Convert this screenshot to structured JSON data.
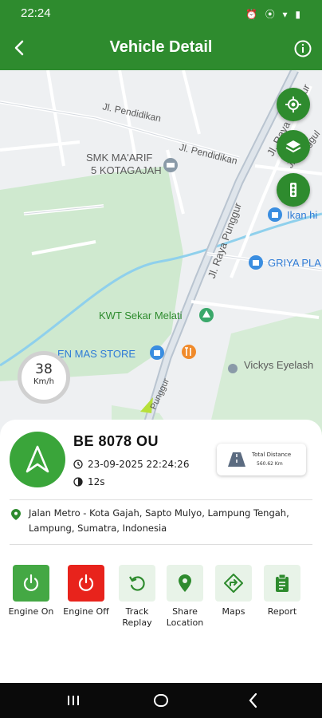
{
  "status": {
    "time": "22:24"
  },
  "header": {
    "title": "Vehicle Detail"
  },
  "map": {
    "labels": {
      "pendidikan1": "Jl. Pendidikan",
      "pendidikan2": "Jl. Pendidikan",
      "smk1": "SMK MA'ARIF",
      "smk2": "5 KOTAGAJAH",
      "raya_punggur_top": "Jl. Raya Punggur",
      "tanggul": "Jl. Tanggul",
      "ikan": "Ikan hi",
      "griya": "GRIYA PLA",
      "raya_punggur_mid": "Jl. Raya Punggur",
      "kwt": "KWT Sekar Melati",
      "store": "EN MAS STORE",
      "vickys": "Vickys Eyelash",
      "punggur_bottom": "Punggur"
    }
  },
  "speed": {
    "value": "38",
    "unit": "Km/h"
  },
  "vehicle": {
    "plate": "BE 8078 OU",
    "datetime": "23-09-2025 22:24:26",
    "duration": "12s",
    "distance_label": "Total Distance",
    "distance_value": "560.62 Km",
    "address_line1": "Jalan Metro - Kota Gajah, Sapto Mulyo, Lampung Tengah,",
    "address_line2": "Lampung, Sumatra, Indonesia"
  },
  "actions": {
    "engine_on": "Engine On",
    "engine_off": "Engine Off",
    "track_replay_1": "Track",
    "track_replay_2": "Replay",
    "share_location_1": "Share",
    "share_location_2": "Location",
    "maps": "Maps",
    "report": "Report"
  },
  "colors": {
    "primary": "#2e8b2e",
    "danger": "#e8231c",
    "tint": "#e8f3e8"
  },
  "icons": [
    "back-arrow-icon",
    "info-icon",
    "locate-icon",
    "layers-icon",
    "traffic-light-icon",
    "navigation-arrow-icon",
    "clock-icon",
    "timer-icon",
    "road-icon",
    "location-pin-icon",
    "power-icon",
    "replay-icon",
    "directions-icon",
    "clipboard-icon"
  ]
}
